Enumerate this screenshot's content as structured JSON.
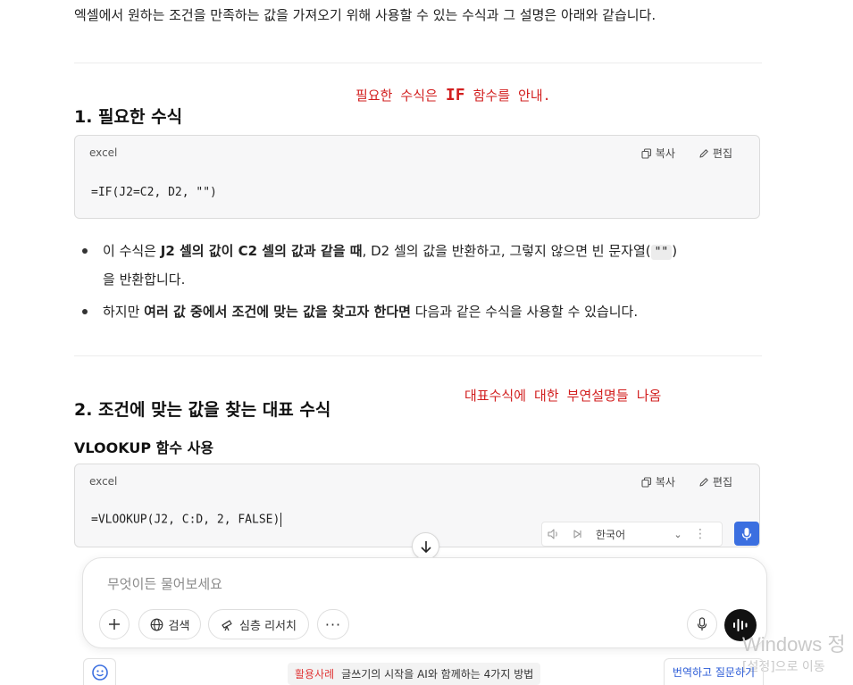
{
  "intro_text": "엑셀에서 원하는 조건을 만족하는 값을 가져오기 위해 사용할 수 있는 수식과 그 설명은 아래와 같습니다.",
  "annotations": {
    "first_pre": "필요한 수식은 ",
    "first_em": "IF",
    "first_post": " 함수를 안내.",
    "second": "대표수식에 대한 부연설명들 나옴"
  },
  "section1": {
    "heading": "1. 필요한 수식",
    "code": {
      "lang": "excel",
      "copy": "복사",
      "edit": "편집",
      "text": "=IF(J2=C2, D2, \"\")"
    }
  },
  "bullets": {
    "b1_p1": "이 수식은 ",
    "b1_b1": "J2 셀의 값이 C2 셀의 값과 같을 때",
    "b1_p2": ", D2 셀의 값을 반환하고, 그렇지 않으면 빈 문자열(",
    "b1_code": "\"\"",
    "b1_p3": ")",
    "b1_p4": "을 반환합니다.",
    "b2_p1": "하지만 ",
    "b2_b1": "여러 값 중에서 조건에 맞는 값을 찾고자 한다면",
    "b2_p2": " 다음과 같은 수식을 사용할 수 있습니다."
  },
  "section2": {
    "heading": "2. 조건에 맞는 값을 찾는 대표 수식",
    "subheading": "VLOOKUP 함수 사용",
    "code": {
      "lang": "excel",
      "copy": "복사",
      "edit": "편집",
      "text": "=VLOOKUP(J2, C:D, 2, FALSE)"
    }
  },
  "voice_bar": {
    "language": "한국어"
  },
  "composer": {
    "placeholder": "무엇이든 물어보세요",
    "search_label": "검색",
    "research_label": "심층 리서치"
  },
  "footer": {
    "promo_tag": "활용사례",
    "promo_text": "글쓰기의 시작을 AI와 함께하는 4가지 방법",
    "translate_label": "번역하고 질문하기"
  },
  "windows_watermark": {
    "line1": "Windows 정",
    "line2": "[설정]으로 이동"
  }
}
